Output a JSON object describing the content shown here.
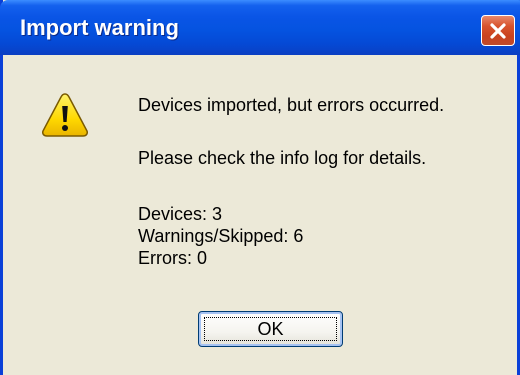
{
  "dialog": {
    "title": "Import warning",
    "icon": "warning-icon",
    "message_lines": [
      "Devices imported, but errors occurred.",
      "Please check the info log for details.",
      "Devices: 3",
      "Warnings/Skipped: 6",
      "Errors: 0"
    ],
    "ok_label": "OK",
    "close_icon": "close-icon"
  },
  "colors": {
    "titlebar": "#0553e0",
    "window_bg": "#ece9d8",
    "close_button": "#d8532d",
    "warning_yellow": "#ffd800"
  }
}
